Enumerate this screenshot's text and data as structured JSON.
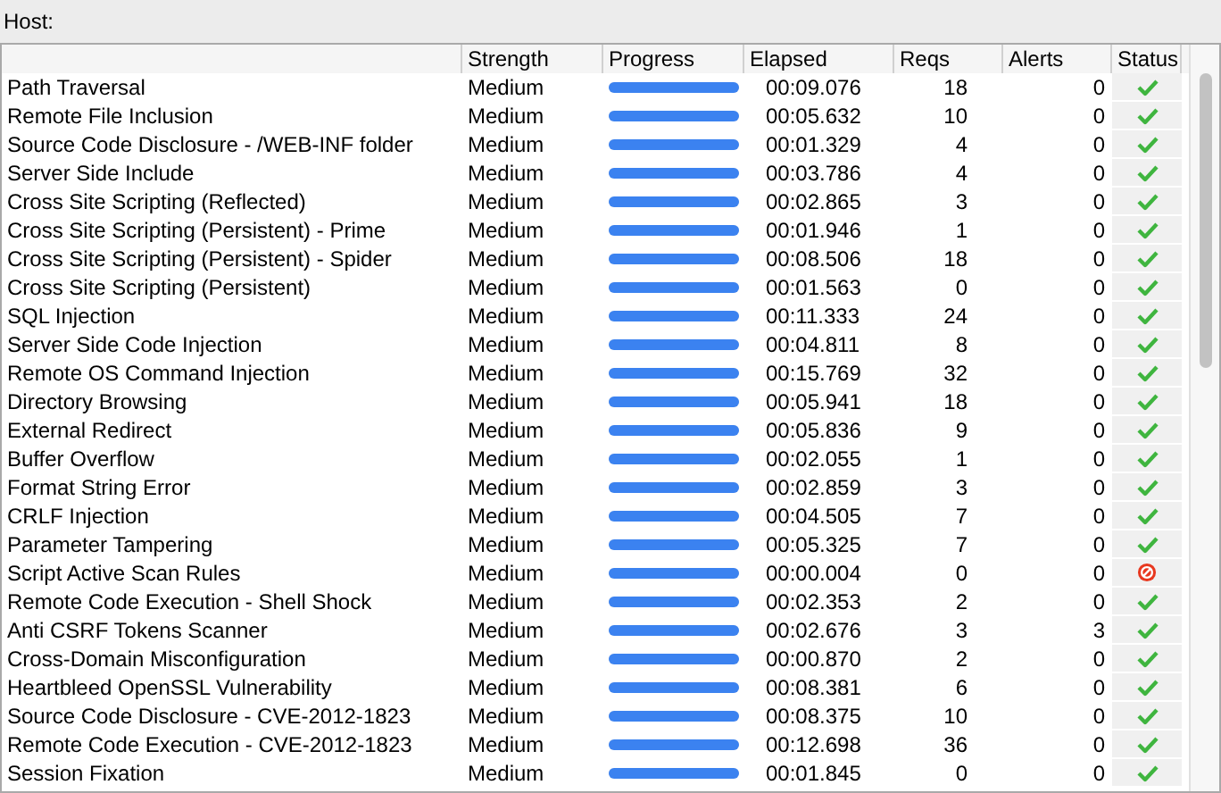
{
  "host_label": "Host:",
  "table": {
    "columns": [
      "Strength",
      "Progress",
      "Elapsed",
      "Reqs",
      "Alerts",
      "Status"
    ],
    "rows": [
      {
        "name": "Path Traversal",
        "strength": "Medium",
        "level": 1,
        "elapsed": "00:09.076",
        "reqs": "18",
        "alerts": "0",
        "kind": "ok"
      },
      {
        "name": "Remote File Inclusion",
        "strength": "Medium",
        "level": 1,
        "elapsed": "00:05.632",
        "reqs": "10",
        "alerts": "0",
        "kind": "ok"
      },
      {
        "name": "Source Code Disclosure - /WEB-INF folder",
        "strength": "Medium",
        "level": 1,
        "elapsed": "00:01.329",
        "reqs": "4",
        "alerts": "0",
        "kind": "ok"
      },
      {
        "name": "Server Side Include",
        "strength": "Medium",
        "level": 1,
        "elapsed": "00:03.786",
        "reqs": "4",
        "alerts": "0",
        "kind": "ok"
      },
      {
        "name": "Cross Site Scripting (Reflected)",
        "strength": "Medium",
        "level": 1,
        "elapsed": "00:02.865",
        "reqs": "3",
        "alerts": "0",
        "kind": "ok"
      },
      {
        "name": "Cross Site Scripting (Persistent) - Prime",
        "strength": "Medium",
        "level": 1,
        "elapsed": "00:01.946",
        "reqs": "1",
        "alerts": "0",
        "kind": "ok"
      },
      {
        "name": "Cross Site Scripting (Persistent) - Spider",
        "strength": "Medium",
        "level": 1,
        "elapsed": "00:08.506",
        "reqs": "18",
        "alerts": "0",
        "kind": "ok"
      },
      {
        "name": "Cross Site Scripting (Persistent)",
        "strength": "Medium",
        "level": 1,
        "elapsed": "00:01.563",
        "reqs": "0",
        "alerts": "0",
        "kind": "ok"
      },
      {
        "name": "SQL Injection",
        "strength": "Medium",
        "level": 1,
        "elapsed": "00:11.333",
        "reqs": "24",
        "alerts": "0",
        "kind": "ok"
      },
      {
        "name": "Server Side Code Injection",
        "strength": "Medium",
        "level": 1,
        "elapsed": "00:04.811",
        "reqs": "8",
        "alerts": "0",
        "kind": "ok"
      },
      {
        "name": "Remote OS Command Injection",
        "strength": "Medium",
        "level": 1,
        "elapsed": "00:15.769",
        "reqs": "32",
        "alerts": "0",
        "kind": "ok"
      },
      {
        "name": "Directory Browsing",
        "strength": "Medium",
        "level": 1,
        "elapsed": "00:05.941",
        "reqs": "18",
        "alerts": "0",
        "kind": "ok"
      },
      {
        "name": "External Redirect",
        "strength": "Medium",
        "level": 1,
        "elapsed": "00:05.836",
        "reqs": "9",
        "alerts": "0",
        "kind": "ok"
      },
      {
        "name": "Buffer Overflow",
        "strength": "Medium",
        "level": 1,
        "elapsed": "00:02.055",
        "reqs": "1",
        "alerts": "0",
        "kind": "ok"
      },
      {
        "name": "Format String Error",
        "strength": "Medium",
        "level": 1,
        "elapsed": "00:02.859",
        "reqs": "3",
        "alerts": "0",
        "kind": "ok"
      },
      {
        "name": "CRLF Injection",
        "strength": "Medium",
        "level": 1,
        "elapsed": "00:04.505",
        "reqs": "7",
        "alerts": "0",
        "kind": "ok"
      },
      {
        "name": "Parameter Tampering",
        "strength": "Medium",
        "level": 1,
        "elapsed": "00:05.325",
        "reqs": "7",
        "alerts": "0",
        "kind": "ok"
      },
      {
        "name": "Script Active Scan Rules",
        "strength": "Medium",
        "level": 1,
        "elapsed": "00:00.004",
        "reqs": "0",
        "alerts": "0",
        "kind": "error"
      },
      {
        "name": "Remote Code Execution - Shell Shock",
        "strength": "Medium",
        "level": 1,
        "elapsed": "00:02.353",
        "reqs": "2",
        "alerts": "0",
        "kind": "ok"
      },
      {
        "name": "Anti CSRF Tokens Scanner",
        "strength": "Medium",
        "level": 1,
        "elapsed": "00:02.676",
        "reqs": "3",
        "alerts": "3",
        "kind": "ok"
      },
      {
        "name": "Cross-Domain Misconfiguration",
        "strength": "Medium",
        "level": 1,
        "elapsed": "00:00.870",
        "reqs": "2",
        "alerts": "0",
        "kind": "ok"
      },
      {
        "name": "Heartbleed OpenSSL Vulnerability",
        "strength": "Medium",
        "level": 1,
        "elapsed": "00:08.381",
        "reqs": "6",
        "alerts": "0",
        "kind": "ok"
      },
      {
        "name": "Source Code Disclosure - CVE-2012-1823",
        "strength": "Medium",
        "level": 1,
        "elapsed": "00:08.375",
        "reqs": "10",
        "alerts": "0",
        "kind": "ok"
      },
      {
        "name": "Remote Code Execution - CVE-2012-1823",
        "strength": "Medium",
        "level": 1,
        "elapsed": "00:12.698",
        "reqs": "36",
        "alerts": "0",
        "kind": "ok"
      },
      {
        "name": "Session Fixation",
        "strength": "Medium",
        "level": 1,
        "elapsed": "00:01.845",
        "reqs": "0",
        "alerts": "0",
        "kind": "ok"
      }
    ]
  }
}
